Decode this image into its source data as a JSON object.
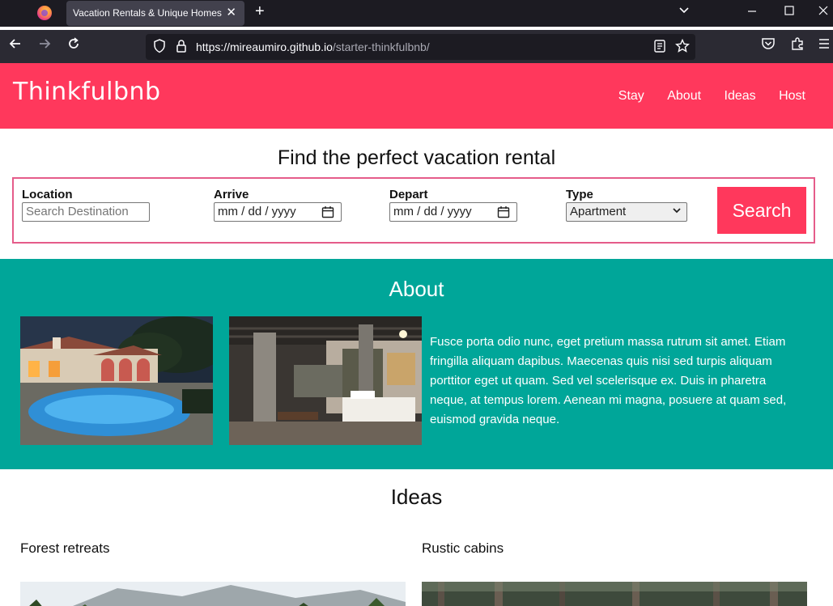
{
  "browser": {
    "tab_title": "Vacation Rentals & Unique Homes",
    "tab_close": "✕",
    "new_tab": "+",
    "url_host": "https://mireaumiro.github.io",
    "url_path": "/starter-thinkfulbnb/"
  },
  "site": {
    "brand": "Thinkfulbnb",
    "nav": [
      "Stay",
      "About",
      "Ideas",
      "Host"
    ],
    "accent_color": "#ff385c",
    "teal_color": "#00a699"
  },
  "search": {
    "title": "Find the perfect vacation rental",
    "location_label": "Location",
    "location_placeholder": "Search Destination",
    "arrive_label": "Arrive",
    "arrive_value": "mm / dd / yyyy",
    "depart_label": "Depart",
    "depart_value": "mm / dd / yyyy",
    "type_label": "Type",
    "type_value": "Apartment",
    "button": "Search"
  },
  "about": {
    "title": "About",
    "text": "Fusce porta odio nunc, eget pretium massa rutrum sit amet. Etiam fringilla aliquam dapibus. Maecenas quis nisi sed turpis aliquam porttitor eget ut quam. Sed vel scelerisque ex. Duis in pharetra neque, at tempus lorem. Aenean mi magna, posuere at quam sed, euismod gravida neque."
  },
  "ideas": {
    "title": "Ideas",
    "items": [
      "Forest retreats",
      "Rustic cabins"
    ]
  }
}
